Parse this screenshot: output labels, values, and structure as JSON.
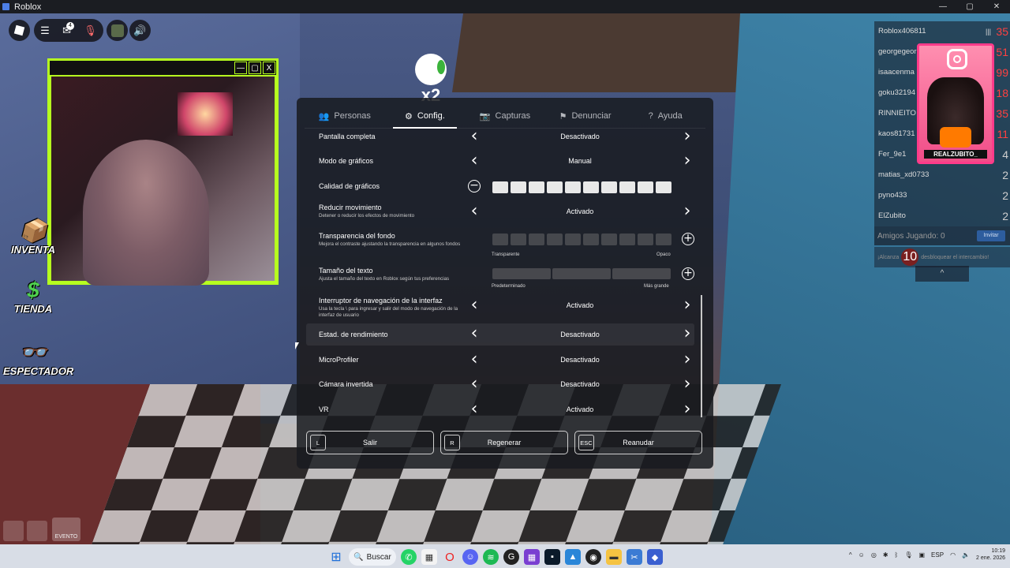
{
  "window": {
    "title": "Roblox",
    "controls": [
      "—",
      "▢",
      "✕"
    ]
  },
  "hud": {
    "notification_count": "4"
  },
  "webcam": {
    "controls": [
      "—",
      "▢",
      "X"
    ]
  },
  "side_menu": [
    {
      "label": "INVENTA",
      "icon": "box-icon"
    },
    {
      "label": "TIENDA",
      "icon": "dollar-icon"
    },
    {
      "label": "ESPECTADOR",
      "icon": "glasses-icon"
    }
  ],
  "bottom_left_labels": {
    "evento": "EVENTO"
  },
  "multiplier": {
    "text": "x2"
  },
  "settings": {
    "tabs": [
      {
        "label": "Personas",
        "icon": "people-icon"
      },
      {
        "label": "Config.",
        "icon": "gear-icon",
        "active": true
      },
      {
        "label": "Capturas",
        "icon": "camera-icon"
      },
      {
        "label": "Denunciar",
        "icon": "flag-icon"
      },
      {
        "label": "Ayuda",
        "icon": "help-icon"
      }
    ],
    "rows": {
      "fullscreen": {
        "label": "Pantalla completa",
        "value": "Desactivado"
      },
      "graphics_mode": {
        "label": "Modo de gráficos",
        "value": "Manual"
      },
      "graphics_quality": {
        "label": "Calidad de gráficos",
        "level": 10,
        "max": 10
      },
      "reduce_motion": {
        "label": "Reducir movimiento",
        "description": "Detener o reducir los efectos de movimiento",
        "value": "Activado"
      },
      "background_transparency": {
        "label": "Transparencia del fondo",
        "description": "Mejora el contraste ajustando la transparencia en algunos fondos",
        "level": 0,
        "max": 10,
        "min_label": "Transparente",
        "max_label": "Opaco"
      },
      "text_size": {
        "label": "Tamaño del texto",
        "description": "Ajusta el tamaño del texto en Roblox según tus preferencias",
        "min_label": "Predeterminado",
        "max_label": "Más grande"
      },
      "ui_navigation": {
        "label": "Interruptor de navegación de la interfaz",
        "description": "Usa la tecla \\ para ingresar y salir del modo de navegación de la interfaz de usuario",
        "value": "Activado"
      },
      "perf_stats": {
        "label": "Estad. de rendimiento",
        "value": "Desactivado"
      },
      "microprofiler": {
        "label": "MicroProfiler",
        "value": "Desactivado"
      },
      "inverted_camera": {
        "label": "Cámara invertida",
        "value": "Desactivado"
      },
      "vr": {
        "label": "VR",
        "value": "Activado"
      }
    },
    "buttons": [
      {
        "key": "L",
        "label": "Salir"
      },
      {
        "key": "R",
        "label": "Regenerar"
      },
      {
        "key": "ESC",
        "label": "Reanudar"
      }
    ]
  },
  "player_list": {
    "players": [
      {
        "name": "Roblox406811",
        "value": "35",
        "highlight": true
      },
      {
        "name": "georgegeor",
        "value": "51"
      },
      {
        "name": "isaacenma",
        "value": "99"
      },
      {
        "name": "goku32194",
        "value": "18"
      },
      {
        "name": "RINNIEITO",
        "value": "35"
      },
      {
        "name": "kaos81731",
        "value": "11"
      },
      {
        "name": "Fer_9e1",
        "value": "4"
      },
      {
        "name": "matias_xd0733",
        "value": "2"
      },
      {
        "name": "pyno433",
        "value": "2"
      },
      {
        "name": "ElZubito",
        "value": "2"
      }
    ],
    "friends_label": "Amigos Jugando: 0",
    "invite_label": "Invitar",
    "reach_prefix": "¡Alcanza",
    "reach_number": "10",
    "reach_suffix": "desbloquear el intercambio!",
    "collapse": "^"
  },
  "instagram": {
    "handle": "REALZUBITO_"
  },
  "taskbar": {
    "search_label": "Buscar",
    "language": "ESP",
    "time": "10:19",
    "date": "2 ene. 2026"
  }
}
